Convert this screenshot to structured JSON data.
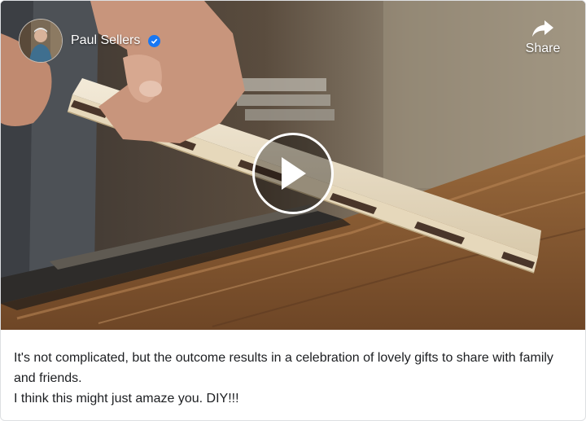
{
  "channel": {
    "name": "Paul Sellers",
    "verified": true,
    "avatar_icon": "avatar-photo",
    "verified_icon": "verified-check-icon"
  },
  "share": {
    "label": "Share",
    "icon": "share-arrow-icon"
  },
  "player": {
    "play_icon": "play-icon"
  },
  "caption": {
    "line1": "It's not complicated, but the outcome results in a celebration of lovely gifts to share with family and friends.",
    "line2": "I think this might just amaze you. DIY!!!"
  },
  "colors": {
    "verified": "#1877f2",
    "caption_text": "#1c1e21",
    "overlay_text": "#ffffff"
  }
}
